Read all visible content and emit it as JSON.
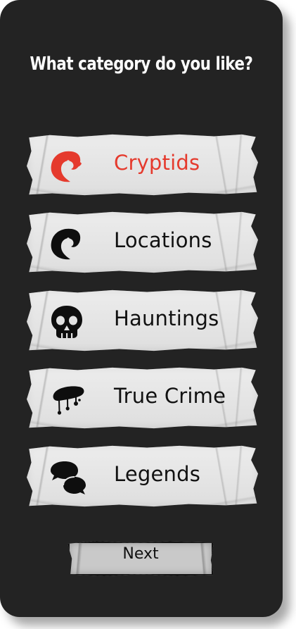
{
  "header": {
    "title": "What category do you like?"
  },
  "categories": [
    {
      "label": "Cryptids",
      "icon": "tentacle-icon",
      "selected": true,
      "color": "#e53a2d"
    },
    {
      "label": "Locations",
      "icon": "tentacle-icon",
      "selected": false,
      "color": "#111111"
    },
    {
      "label": "Hauntings",
      "icon": "skull-icon",
      "selected": false,
      "color": "#111111"
    },
    {
      "label": "True Crime",
      "icon": "blood-drip-icon",
      "selected": false,
      "color": "#111111"
    },
    {
      "label": "Legends",
      "icon": "speech-bubbles-icon",
      "selected": false,
      "color": "#111111"
    }
  ],
  "footer": {
    "next_label": "Next"
  },
  "colors": {
    "background": "#232323",
    "card": "#e2e2e2",
    "accent": "#e53a2d",
    "text": "#111111",
    "title": "#ffffff"
  }
}
